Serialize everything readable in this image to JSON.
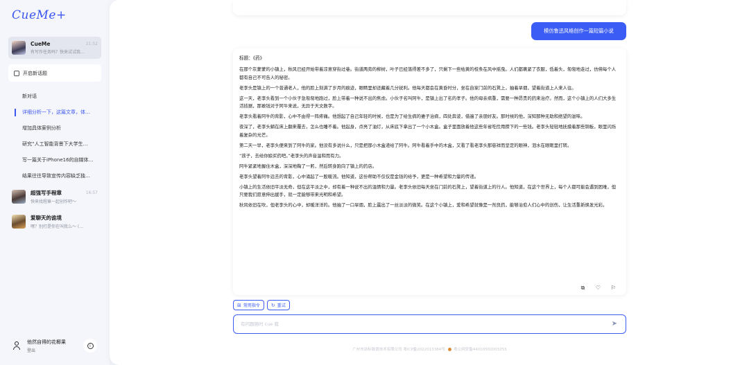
{
  "app": {
    "logo": "CueMe+"
  },
  "sidebar": {
    "sessions": [
      {
        "name": "CueMe",
        "time": "21:52",
        "preview": "有写作任务吗？快来试试我…"
      },
      {
        "name": "超强写手程章",
        "time": "16:57",
        "preview": "快来找程章一起创作吧～"
      },
      {
        "name": "爱聊天的诡境",
        "time": "",
        "preview": "嘿？别打是你在叫我么～ (…"
      }
    ],
    "new_chat_label": "开启新话题",
    "history": [
      "新对话",
      "详细分析一下，这篇文章，体…",
      "增加具体案例分析",
      "研究“人工智能背景下大学生…",
      "写一篇关于iPhone16的自媒体…",
      "结果往往导致宣传内容缺乏独…"
    ],
    "user": {
      "name": "他然自得的花椰果",
      "logout": "登出"
    }
  },
  "chat": {
    "user_message": "模仿鲁迅风格创作一篇短篇小说",
    "answer": {
      "title": "标题：《药》",
      "paragraphs": [
        "在那个灰蒙蒙的小镇上，秋风已经开始带着凉意穿街过巷。街道两旁的柳树，叶子已经落得差不多了，只剩下一些枯黄的枝条在风中摇曳。人们都裹紧了衣服，低着头，匆匆地走过，仿佛每个人都有自己不可告人的秘密。",
        "老李头是镇上的一个普通老人，他的脸上刻满了岁月的痕迹，眼睛里却还藏着几分锐利。他每天都会在黄昏时分，坐在自家门前的石凳上，抽着旱烟，望着街道上人来人往。",
        "这一天，老李头看到一个小伙子急匆匆地跑过，脸上带着一种说不出的焦虑。小伙子名叫阿牛，是镇上出了名的孝子。他的母亲病重，需要一种昂贵的药来治疗。然而，这个小镇上的人们大多生活拮据，那敢钱对于阿牛来说，无异于天文数字。",
        "老李头看着阿牛的背影，心中不由得一阵疼痛。他想起了自己年轻的时候，也是为了给生病的妻子治病，四处奔波，借遍了亲朋好友。那时候的他，深知那种无助和绝望的滋味。",
        "夜深了，老李头躺在床上翻来覆去，怎么也睡不着。他起身，点亮了油灯，从床底下拿出了一个小木盒。盒子里面放着他这些年省吃俭用攒下的一些钱。老李头轻轻地抚摸着那些铜板，眼里闪烁着复杂的光芒。",
        "第二天一早，老李头便来到了阿牛的家。他没有多说什么，只是把那小木盒递给了阿牛。阿牛看着手中的木盒，又看了看老李头那慈祥而坚定的眼神，泪水在眼眶里打转。",
        "“孩子，去给你娘买药吧。”老李头的声音温和而有力。",
        "阿牛紧紧地握住木盒，深深地鞠了一躬，然后转身跑向了镇上的药店。",
        "老李头望着阿牛远去的背影，心中涌起了一股暖流。他知道，这份帮助不仅仅是金钱的给予，更是一种希望和力量的传递。",
        "小镇上的生活依旧平淡无奇，但在这平淡之中，却有着一种说不出的温情和力量。老李头依旧每天坐在门前的石凳上，望着街道上的行人。他知道，在这个世界上，每个人都可能会遇到困难，但只要我们愿意伸出援手，就一定能够带来光明和希望。",
        "秋风依旧在吹，但老李头的心中，却暖洋洋的。他抽了一口旱烟，脸上露出了一丝淡淡的微笑。在这个小镇上，爱和希望就像是一剂良药，能够治愈人们心中的创伤，让生活重新焕发光彩。"
      ]
    },
    "tools": {
      "common_commands": "常用指令",
      "retry": "重试"
    },
    "input": {
      "placeholder": "有问题随时 cue 我"
    },
    "footer": {
      "company_icp": "广州市劲标致景技术有限公司 粤ICP备2022013384号",
      "police": "粤公网安备44010502003255"
    }
  }
}
